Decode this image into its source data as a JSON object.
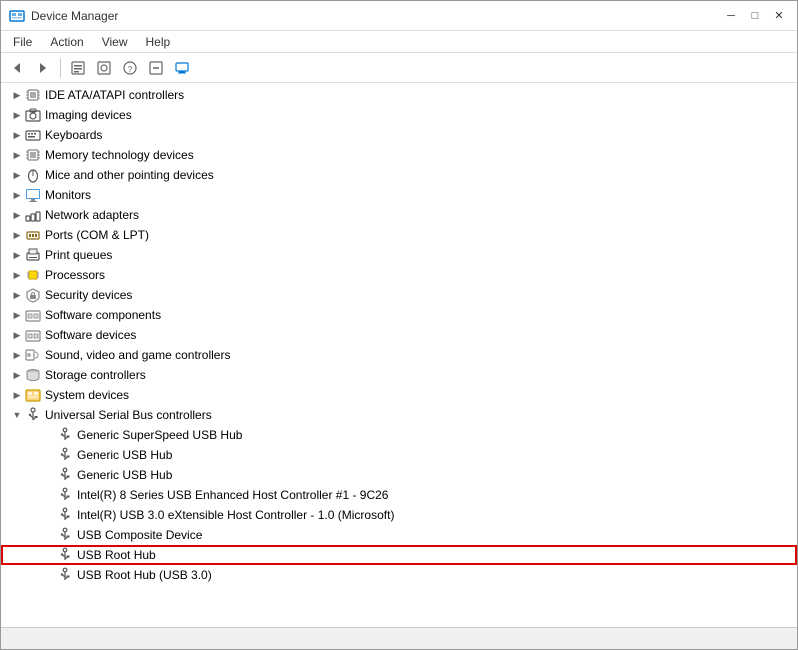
{
  "window": {
    "title": "Device Manager",
    "minimize_label": "─",
    "maximize_label": "□",
    "close_label": "✕"
  },
  "menu": {
    "items": [
      "File",
      "Action",
      "View",
      "Help"
    ]
  },
  "toolbar": {
    "buttons": [
      "←",
      "→",
      "⊞",
      "▣",
      "?",
      "⊟",
      "🖥"
    ]
  },
  "tree": {
    "items": [
      {
        "id": "ide",
        "label": "IDE ATA/ATAPI controllers",
        "indent": 1,
        "expanded": false,
        "icon": "chip"
      },
      {
        "id": "imaging",
        "label": "Imaging devices",
        "indent": 1,
        "expanded": false,
        "icon": "camera"
      },
      {
        "id": "keyboards",
        "label": "Keyboards",
        "indent": 1,
        "expanded": false,
        "icon": "keyboard"
      },
      {
        "id": "memory",
        "label": "Memory technology devices",
        "indent": 1,
        "expanded": false,
        "icon": "chip"
      },
      {
        "id": "mice",
        "label": "Mice and other pointing devices",
        "indent": 1,
        "expanded": false,
        "icon": "mouse"
      },
      {
        "id": "monitors",
        "label": "Monitors",
        "indent": 1,
        "expanded": false,
        "icon": "monitor"
      },
      {
        "id": "network",
        "label": "Network adapters",
        "indent": 1,
        "expanded": false,
        "icon": "network"
      },
      {
        "id": "ports",
        "label": "Ports (COM & LPT)",
        "indent": 1,
        "expanded": false,
        "icon": "ports"
      },
      {
        "id": "print",
        "label": "Print queues",
        "indent": 1,
        "expanded": false,
        "icon": "printer"
      },
      {
        "id": "processors",
        "label": "Processors",
        "indent": 1,
        "expanded": false,
        "icon": "cpu"
      },
      {
        "id": "security",
        "label": "Security devices",
        "indent": 1,
        "expanded": false,
        "icon": "security"
      },
      {
        "id": "sw_components",
        "label": "Software components",
        "indent": 1,
        "expanded": false,
        "icon": "sw"
      },
      {
        "id": "sw_devices",
        "label": "Software devices",
        "indent": 1,
        "expanded": false,
        "icon": "sw"
      },
      {
        "id": "sound",
        "label": "Sound, video and game controllers",
        "indent": 1,
        "expanded": false,
        "icon": "sound"
      },
      {
        "id": "storage",
        "label": "Storage controllers",
        "indent": 1,
        "expanded": false,
        "icon": "storage"
      },
      {
        "id": "system",
        "label": "System devices",
        "indent": 1,
        "expanded": false,
        "icon": "system"
      },
      {
        "id": "usb",
        "label": "Universal Serial Bus controllers",
        "indent": 1,
        "expanded": true,
        "icon": "usb"
      },
      {
        "id": "usb_1",
        "label": "Generic SuperSpeed USB Hub",
        "indent": 2,
        "expanded": false,
        "icon": "usb_dev"
      },
      {
        "id": "usb_2",
        "label": "Generic USB Hub",
        "indent": 2,
        "expanded": false,
        "icon": "usb_dev"
      },
      {
        "id": "usb_3",
        "label": "Generic USB Hub",
        "indent": 2,
        "expanded": false,
        "icon": "usb_dev"
      },
      {
        "id": "usb_4",
        "label": "Intel(R) 8 Series USB Enhanced Host Controller #1 - 9C26",
        "indent": 2,
        "expanded": false,
        "icon": "usb_dev"
      },
      {
        "id": "usb_5",
        "label": "Intel(R) USB 3.0 eXtensible Host Controller - 1.0 (Microsoft)",
        "indent": 2,
        "expanded": false,
        "icon": "usb_dev"
      },
      {
        "id": "usb_6",
        "label": "USB Composite Device",
        "indent": 2,
        "expanded": false,
        "icon": "usb_dev"
      },
      {
        "id": "usb_7",
        "label": "USB Root Hub",
        "indent": 2,
        "expanded": false,
        "icon": "usb_dev",
        "selected": true
      },
      {
        "id": "usb_8",
        "label": "USB Root Hub (USB 3.0)",
        "indent": 2,
        "expanded": false,
        "icon": "usb_dev"
      }
    ]
  },
  "status": {
    "text": ""
  },
  "colors": {
    "accent": "#0078d7",
    "selection_border": "#e00000"
  }
}
